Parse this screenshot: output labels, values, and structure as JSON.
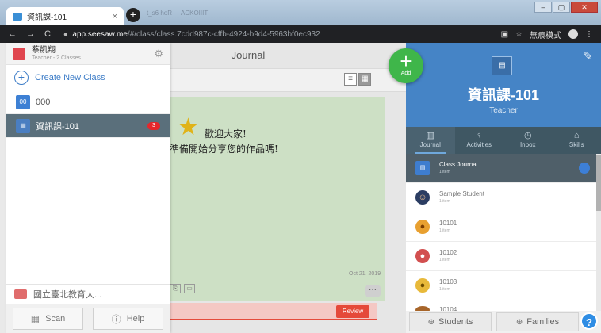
{
  "browser": {
    "tab_title": "資訊課-101",
    "tab_close": "×",
    "new_tab": "+",
    "faded_tab_1": "t_s6 hoR",
    "faded_tab_2": "ACKOIIIT",
    "faded_right": "無痕模式",
    "url_host": "app.seesaw.me",
    "url_path": "/#/class/class.7cdd987c-cffb-4924-b9d4-5963bf0ec932",
    "incognito_label": "無痕模式",
    "win_min": "–",
    "win_max": "▢",
    "win_close": "✕"
  },
  "drawer": {
    "profile_name": "蔡凱翔",
    "profile_role": "Teacher - 2 Classes",
    "create_label": "Create New Class",
    "classes": [
      {
        "icon": "00",
        "name": "000"
      },
      {
        "icon": "▤",
        "name": "資訊課-101",
        "count": "3"
      }
    ],
    "school": "國立臺北教育大...",
    "scan_label": "Scan",
    "help_label": "Help"
  },
  "journal": {
    "title": "Journal",
    "post_line1": "歡迎大家!",
    "post_line2": "準備開始分享您的作品嗎!",
    "post_date": "Oct 21, 2019",
    "review_label": "Review",
    "fab_label": "Add"
  },
  "right_panel": {
    "class_name": "資訊課-101",
    "class_role": "Teacher",
    "tabs": [
      {
        "icon": "▥",
        "label": "Journal"
      },
      {
        "icon": "♀",
        "label": "Activities"
      },
      {
        "icon": "◷",
        "label": "Inbox"
      },
      {
        "icon": "⌂",
        "label": "Skills"
      }
    ],
    "list": [
      {
        "name": "Class Journal",
        "sub": "1 item"
      },
      {
        "name": "Sample Student",
        "sub": "1 item"
      },
      {
        "name": "10101",
        "sub": "1 item"
      },
      {
        "name": "10102",
        "sub": "1 item"
      },
      {
        "name": "10103",
        "sub": "1 item"
      },
      {
        "name": "10104",
        "sub": ""
      }
    ],
    "students_label": "Students",
    "families_label": "Families",
    "help_fab": "?"
  },
  "colors": {
    "accent_blue": "#4584c6",
    "fab_green": "#3fb64a",
    "review_red": "#e5493a"
  }
}
